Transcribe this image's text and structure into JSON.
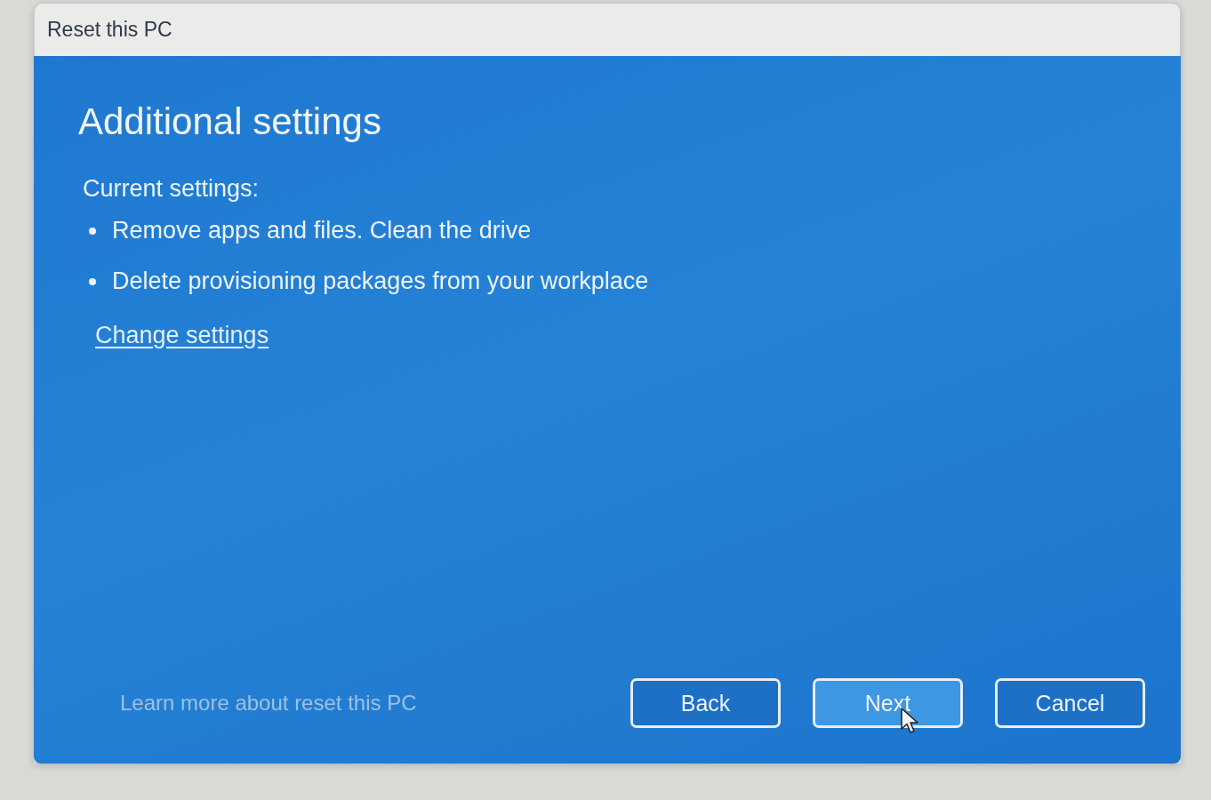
{
  "window": {
    "title": "Reset this PC"
  },
  "page": {
    "heading": "Additional settings",
    "section_label": "Current settings:",
    "settings": [
      "Remove apps and files. Clean the drive",
      "Delete provisioning packages from your workplace"
    ],
    "change_link": "Change settings"
  },
  "footer": {
    "learn_more_link": "Learn more about reset this PC",
    "buttons": [
      {
        "label": "Back",
        "hovered": false
      },
      {
        "label": "Next",
        "hovered": true
      },
      {
        "label": "Cancel",
        "hovered": false
      }
    ]
  }
}
